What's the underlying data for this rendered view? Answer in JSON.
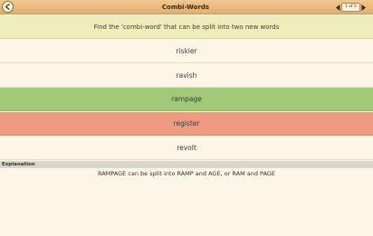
{
  "header": {
    "title": "Combi-Words",
    "page_counter": "1 of 5",
    "back_icon": "back-arrow-icon"
  },
  "question": {
    "prompt": "Find the 'combi-word' that can be split into two new words"
  },
  "options": [
    {
      "label": "riskier",
      "state": "neutral"
    },
    {
      "label": "ravish",
      "state": "neutral"
    },
    {
      "label": "rampage",
      "state": "correct"
    },
    {
      "label": "register",
      "state": "wrong"
    },
    {
      "label": "revolt",
      "state": "neutral"
    }
  ],
  "explanation": {
    "header": "Explanation",
    "text": "RAMPAGE can be split into RAMP and AGE, or RAM and PAGE"
  },
  "colors": {
    "titlebar": "#e8b87a",
    "correct": "#a2c978",
    "wrong": "#ef9a82",
    "prompt_band": "#eeeebd",
    "background": "#fdf6e6"
  }
}
